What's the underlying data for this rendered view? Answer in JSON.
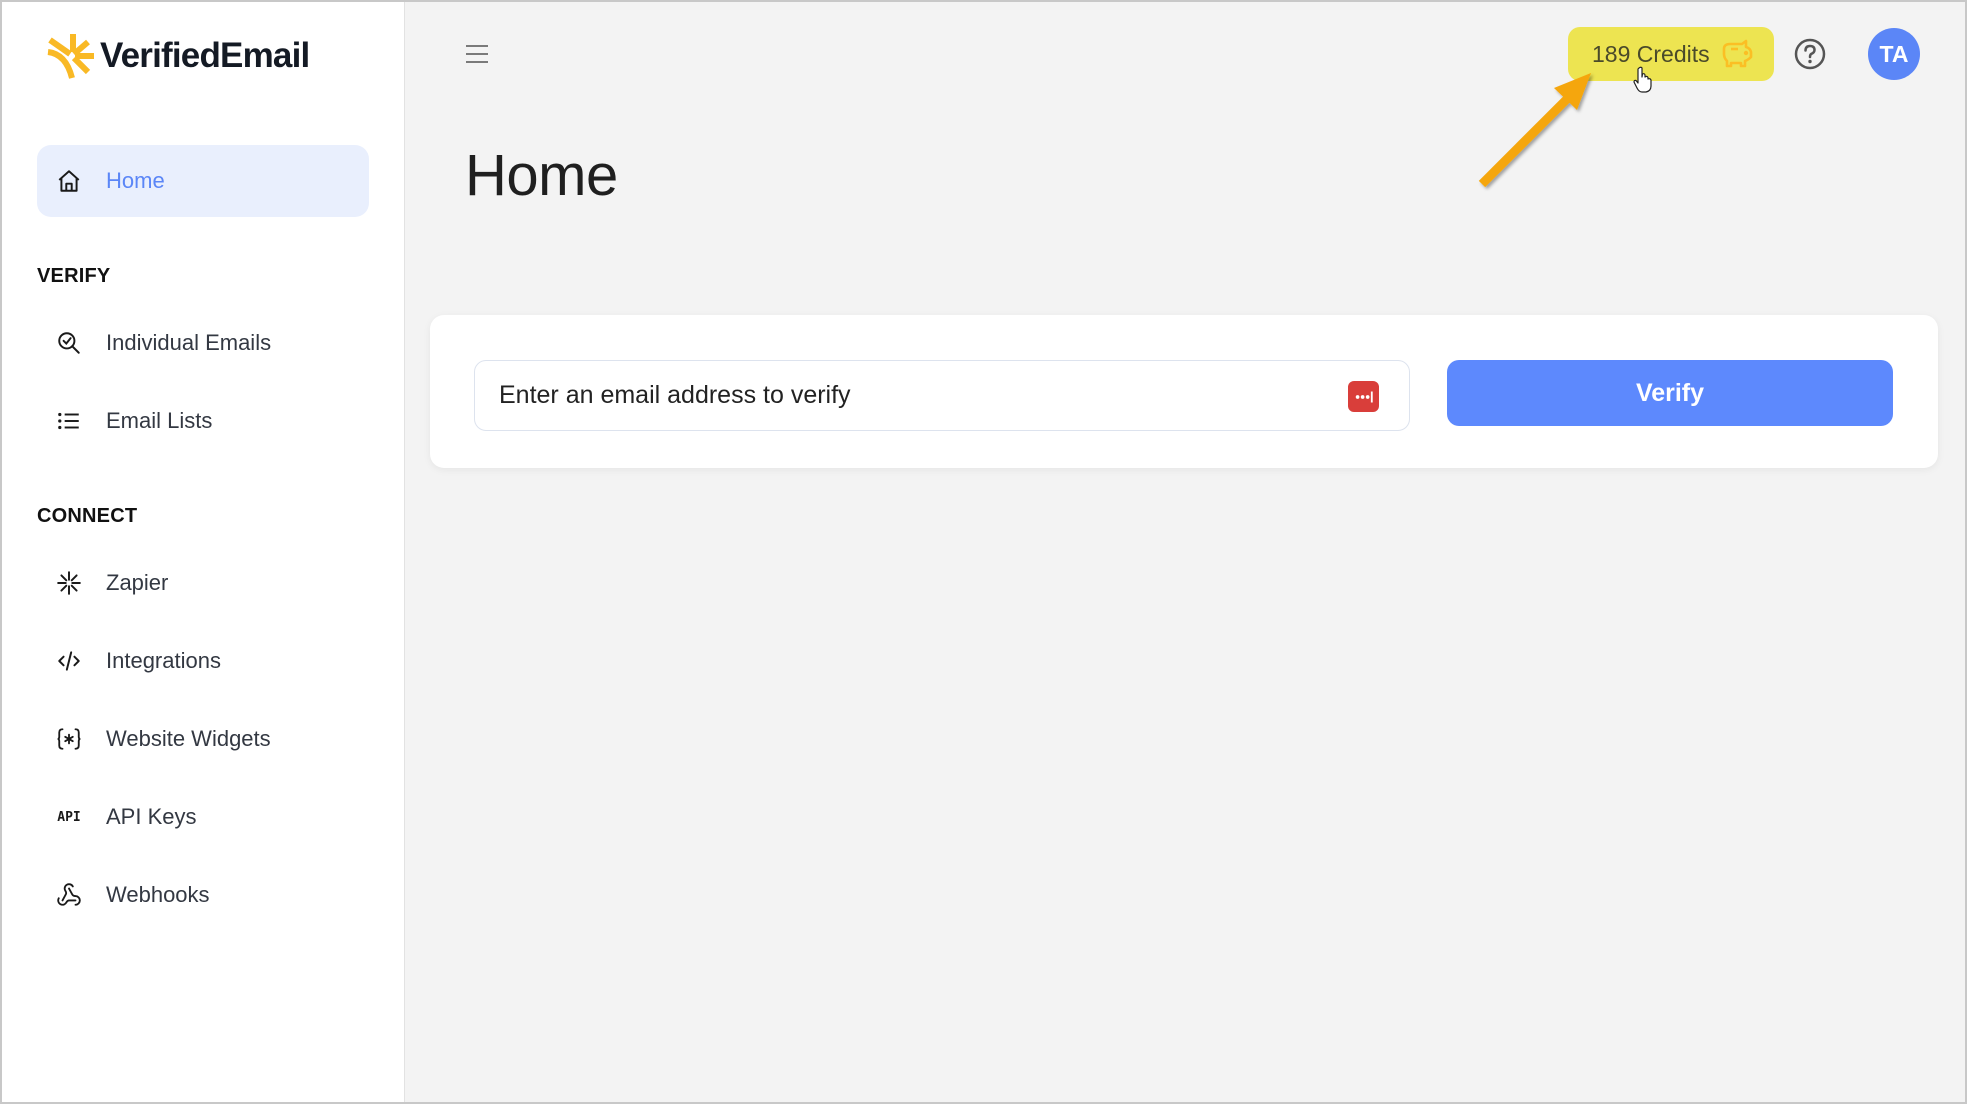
{
  "brand": {
    "name": "VerifiedEmail",
    "logo_color": "#f9b925"
  },
  "sidebar": {
    "home": {
      "label": "Home",
      "icon": "home-icon",
      "active": true
    },
    "sections": [
      {
        "title": "VERIFY",
        "items": [
          {
            "label": "Individual Emails",
            "icon": "search-check-icon"
          },
          {
            "label": "Email Lists",
            "icon": "list-icon"
          }
        ]
      },
      {
        "title": "CONNECT",
        "items": [
          {
            "label": "Zapier",
            "icon": "zapier-icon"
          },
          {
            "label": "Integrations",
            "icon": "code-icon"
          },
          {
            "label": "Website Widgets",
            "icon": "braces-asterisk-icon"
          },
          {
            "label": "API Keys",
            "icon": "api-icon",
            "glyph": "API"
          },
          {
            "label": "Webhooks",
            "icon": "webhook-icon"
          }
        ]
      }
    ]
  },
  "header": {
    "credits_label": "189 Credits",
    "credits_bg": "#ede451",
    "avatar_initials": "TA",
    "avatar_color": "#5b86f7"
  },
  "main": {
    "title": "Home",
    "email_input": {
      "placeholder": "Enter an email address to verify",
      "value": ""
    },
    "verify_label": "Verify",
    "accent": "#5d89fd"
  },
  "annotation": {
    "arrow_color": "#f5a60a"
  }
}
